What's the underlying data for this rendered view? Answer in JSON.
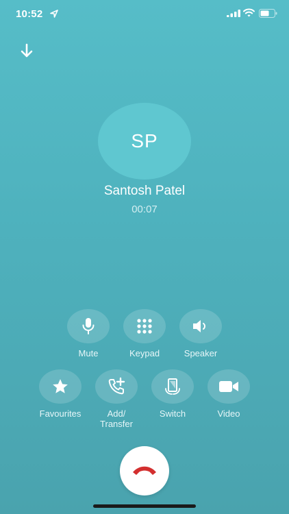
{
  "status_bar": {
    "time": "10:52"
  },
  "call": {
    "initials": "SP",
    "name": "Santosh Patel",
    "duration": "00:07"
  },
  "controls": {
    "mute": "Mute",
    "keypad": "Keypad",
    "speaker": "Speaker",
    "favourites": "Favourites",
    "add_transfer": "Add/\nTransfer",
    "switch": "Switch",
    "video": "Video"
  },
  "colors": {
    "accent": "#56bdc8",
    "end_call": "#d32f2f"
  },
  "icons": [
    "location-arrow-icon",
    "signal-icon",
    "wifi-icon",
    "battery-icon",
    "arrow-down-icon",
    "microphone-icon",
    "keypad-icon",
    "speaker-icon",
    "star-icon",
    "add-call-icon",
    "switch-device-icon",
    "video-camera-icon",
    "hang-up-icon"
  ]
}
